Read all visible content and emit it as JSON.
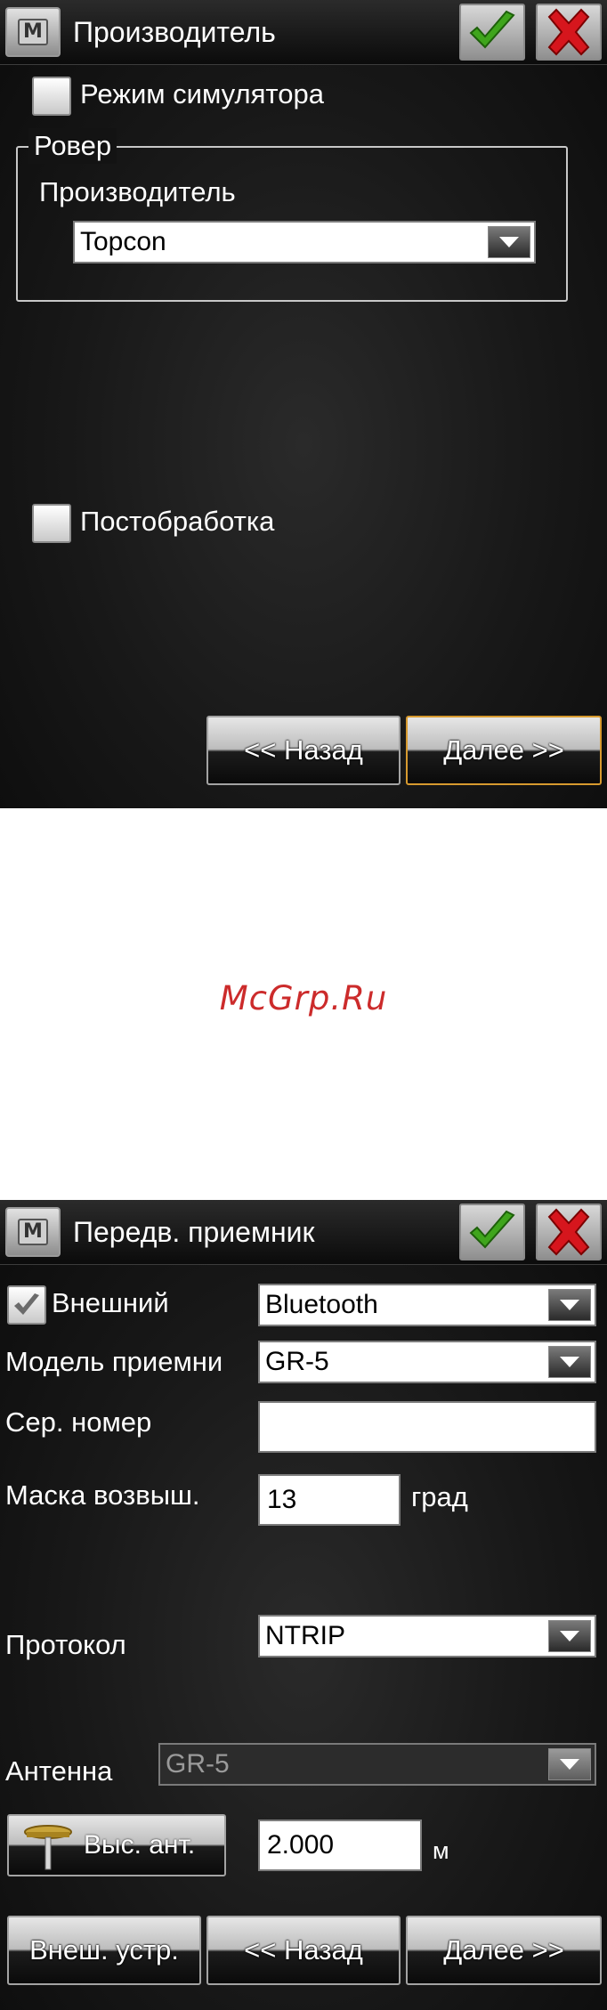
{
  "screen1": {
    "menu_icon": "M",
    "title": "Производитель",
    "ok_icon": "checkmark-icon",
    "cancel_icon": "close-icon",
    "simulator_label": "Режим симулятора",
    "simulator_checked": false,
    "group_title": "Ровер",
    "manufacturer_label": "Производитель",
    "manufacturer_value": "Topcon",
    "postprocessing_label": "Постобработка",
    "postprocessing_checked": false,
    "back_label": "<< Назад",
    "next_label": "Далее >>"
  },
  "watermark": "McGrp.Ru",
  "screen2": {
    "menu_icon": "M",
    "title": "Передв. приемник",
    "external_label": "Внешний",
    "external_checked": true,
    "connection_value": "Bluetooth",
    "model_label": "Модель приемни",
    "model_value": "GR-5",
    "serial_label": "Сер. номер",
    "serial_value": "",
    "elevation_mask_label": "Маска возвыш.",
    "elevation_mask_value": "13",
    "elevation_mask_unit": "град",
    "protocol_label": "Протокол",
    "protocol_value": "NTRIP",
    "antenna_label": "Антенна",
    "antenna_value": "GR-5",
    "antenna_height_button": "Выс. ант.",
    "antenna_height_value": "2.000",
    "antenna_height_unit": "м",
    "ext_device_label": "Внеш. устр.",
    "back_label": "<< Назад",
    "next_label": "Далее >>"
  },
  "colors": {
    "background": "#151515",
    "accent_focus": "#d79a2f",
    "check_green": "#3fa51c",
    "close_red": "#d6161d",
    "watermark": "#cc2b2b"
  }
}
